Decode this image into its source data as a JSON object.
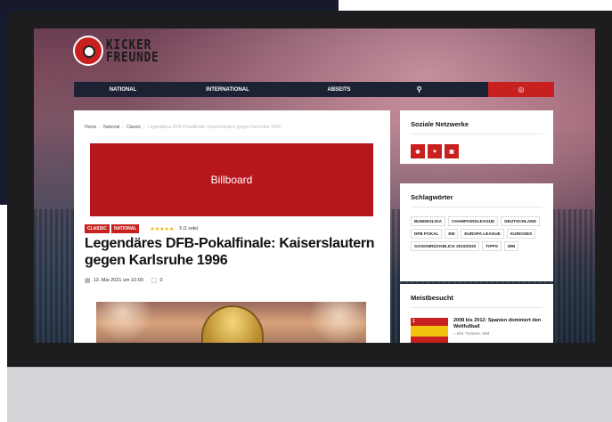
{
  "site": {
    "logo_line1": "KICKER",
    "logo_line2": "FREUNDE"
  },
  "nav": {
    "items": [
      "NATIONAL",
      "INTERNATIONAL",
      "ABSEITS"
    ],
    "search_icon": "search-icon",
    "globe_icon": "globe-icon"
  },
  "breadcrumb": {
    "home": "Home",
    "national": "National",
    "classic": "Classic",
    "current": "Legendäres DFB-Pokalfinale: Kaiserslautern gegen Karlsruhe 1996"
  },
  "billboard": {
    "label": "Billboard"
  },
  "article": {
    "tags": [
      "CLASSIC",
      "NATIONAL"
    ],
    "stars": "★★★★★",
    "rating_text": "5 (1 vote)",
    "title": "Legendäres DFB-Pokalfinale: Kaiserslautern gegen Karlsruhe 1996",
    "date": "13. Mai 2021 um 10:00",
    "comments": "0"
  },
  "sidebar": {
    "social_title": "Soziale Netzwerke",
    "social_icons": [
      "instagram-icon",
      "twitter-icon",
      "instagram-icon"
    ],
    "tags_title": "Schlagwörter",
    "tags": [
      "BUNDESLIGA",
      "CHAMPIONSLEAGUE",
      "DEUTSCHLAND",
      "DFB POKAL",
      "EM",
      "EUROPA LEAGUE",
      "KURIOSES",
      "SAISONRÜCKBLICK 2019/2020",
      "TIPPS",
      "WM"
    ],
    "popular_title": "Meistbesucht",
    "popular": [
      {
        "num": "1",
        "title": "2008 bis 2012: Spanien dominiert den Weltfußball",
        "tags": "EM, Turniere, WM"
      }
    ]
  },
  "colors": {
    "accent": "#c8201f",
    "navbar": "#1c2233"
  }
}
